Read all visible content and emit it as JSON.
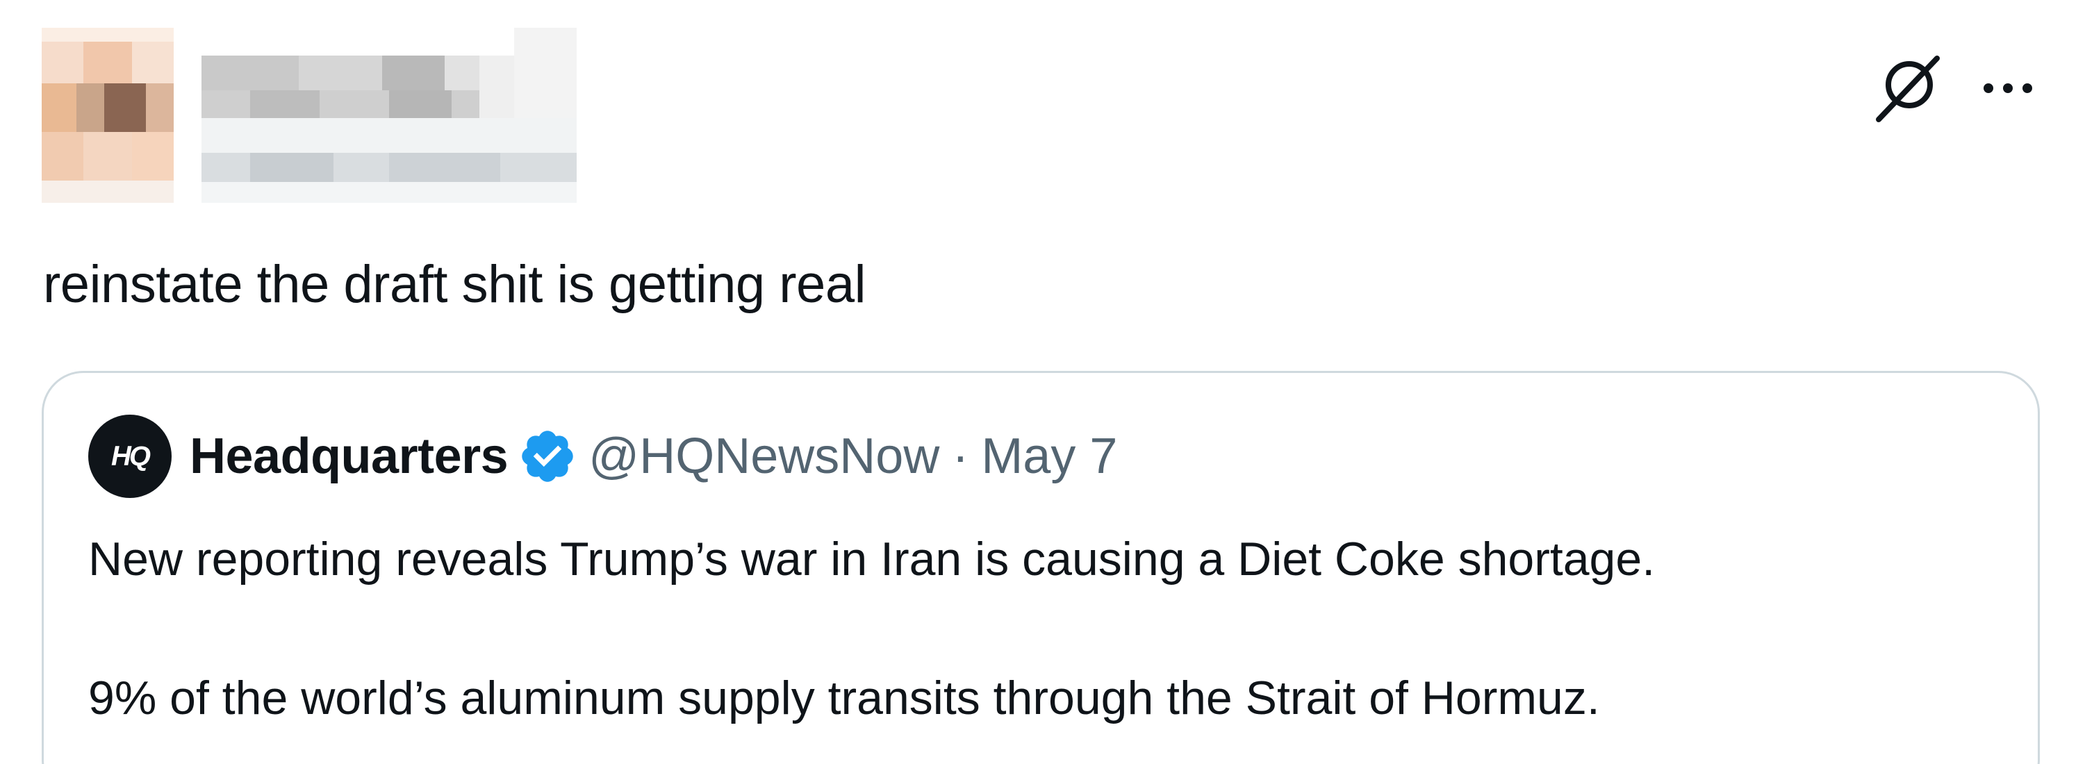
{
  "tweet": {
    "text": "reinstate the draft shit is getting real",
    "more_label": "···"
  },
  "quoted_tweet": {
    "avatar_text": "HQ",
    "display_name": "Headquarters",
    "handle": "@HQNewsNow",
    "separator": "·",
    "date": "May 7",
    "paragraphs": [
      "New reporting reveals Trump’s war in Iran is causing a Diet Coke shortage.",
      "9% of the world’s aluminum supply transits through the Strait of Hormuz."
    ]
  },
  "colors": {
    "text_primary": "#0f1419",
    "text_secondary": "#536471",
    "verified_blue": "#1d9bf0",
    "card_border": "#cfd9de"
  },
  "icons": {
    "grok": "grok-icon",
    "more": "more-icon",
    "verified": "verified-badge-icon"
  }
}
